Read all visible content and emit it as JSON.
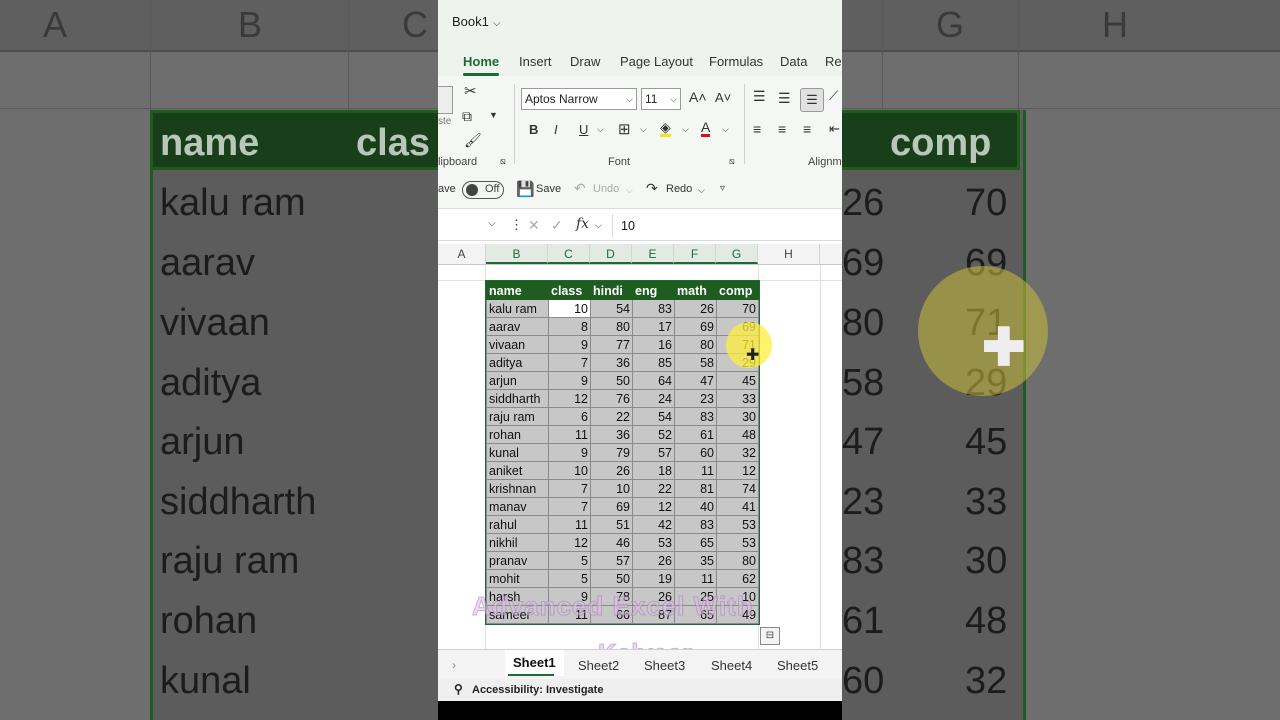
{
  "window": {
    "title": "Book1"
  },
  "ribbon_tabs": [
    "Home",
    "Insert",
    "Draw",
    "Page Layout",
    "Formulas",
    "Data",
    "Rev"
  ],
  "ribbon": {
    "font_name": "Aptos Narrow",
    "font_size": "11",
    "grow_font": "A˄",
    "shrink_font": "A˅",
    "bold": "B",
    "italic": "I",
    "underline": "U",
    "clipboard_label": "lipboard",
    "paste_label": "ste",
    "font_label": "Font",
    "alignment_label": "Alignm"
  },
  "quick_access": {
    "autosave_label": "ave",
    "autosave_state": "Off",
    "save_label": "Save",
    "undo_label": "Undo",
    "redo_label": "Redo"
  },
  "formula_bar": {
    "fx": "fx",
    "value": "10"
  },
  "columns": [
    "A",
    "B",
    "C",
    "D",
    "E",
    "F",
    "G",
    "H"
  ],
  "table": {
    "headers": [
      "name",
      "class",
      "hindi",
      "eng",
      "math",
      "comp"
    ],
    "rows": [
      [
        "kalu ram",
        10,
        54,
        83,
        26,
        70
      ],
      [
        "aarav",
        8,
        80,
        17,
        69,
        69
      ],
      [
        "vivaan",
        9,
        77,
        16,
        80,
        71
      ],
      [
        "aditya",
        7,
        36,
        85,
        58,
        29
      ],
      [
        "arjun",
        9,
        50,
        64,
        47,
        45
      ],
      [
        "siddharth",
        12,
        76,
        24,
        23,
        33
      ],
      [
        "raju ram",
        6,
        22,
        54,
        83,
        30
      ],
      [
        "rohan",
        11,
        36,
        52,
        61,
        48
      ],
      [
        "kunal",
        9,
        79,
        57,
        60,
        32
      ],
      [
        "aniket",
        10,
        26,
        18,
        11,
        12
      ],
      [
        "krishnan",
        7,
        10,
        22,
        81,
        74
      ],
      [
        "manav",
        7,
        69,
        12,
        40,
        41
      ],
      [
        "rahul",
        11,
        51,
        42,
        83,
        53
      ],
      [
        "nikhil",
        12,
        46,
        53,
        65,
        53
      ],
      [
        "pranav",
        5,
        57,
        26,
        35,
        80
      ],
      [
        "mohit",
        5,
        50,
        19,
        11,
        62
      ],
      [
        "harsh",
        9,
        78,
        26,
        25,
        10
      ],
      [
        "sameer",
        11,
        66,
        87,
        65,
        49
      ]
    ]
  },
  "sheets": [
    "Sheet1",
    "Sheet2",
    "Sheet3",
    "Sheet4",
    "Sheet5"
  ],
  "status": {
    "accessibility": "Accessibility: Investigate"
  },
  "watermark": {
    "line1": "Advanced Excel With",
    "line2": "Kalveer"
  },
  "background": {
    "columns": [
      "A",
      "B",
      "C",
      "G",
      "H"
    ],
    "names": [
      "name",
      "kalu ram",
      "aarav",
      "vivaan",
      "aditya",
      "arjun",
      "siddharth",
      "raju ram",
      "rohan",
      "kunal"
    ],
    "comp_header": "comp",
    "clas_header": "clas",
    "comp_values": [
      "70",
      "69",
      "71",
      "29",
      "45",
      "33",
      "30",
      "48",
      "32"
    ],
    "math_values": [
      "26",
      "69",
      "80",
      "58",
      "47",
      "23",
      "83",
      "61",
      "60"
    ]
  },
  "colors": {
    "accent": "#1d6b34",
    "header_fill": "#1e5c20",
    "cell_fill": "#c7c7c7"
  }
}
